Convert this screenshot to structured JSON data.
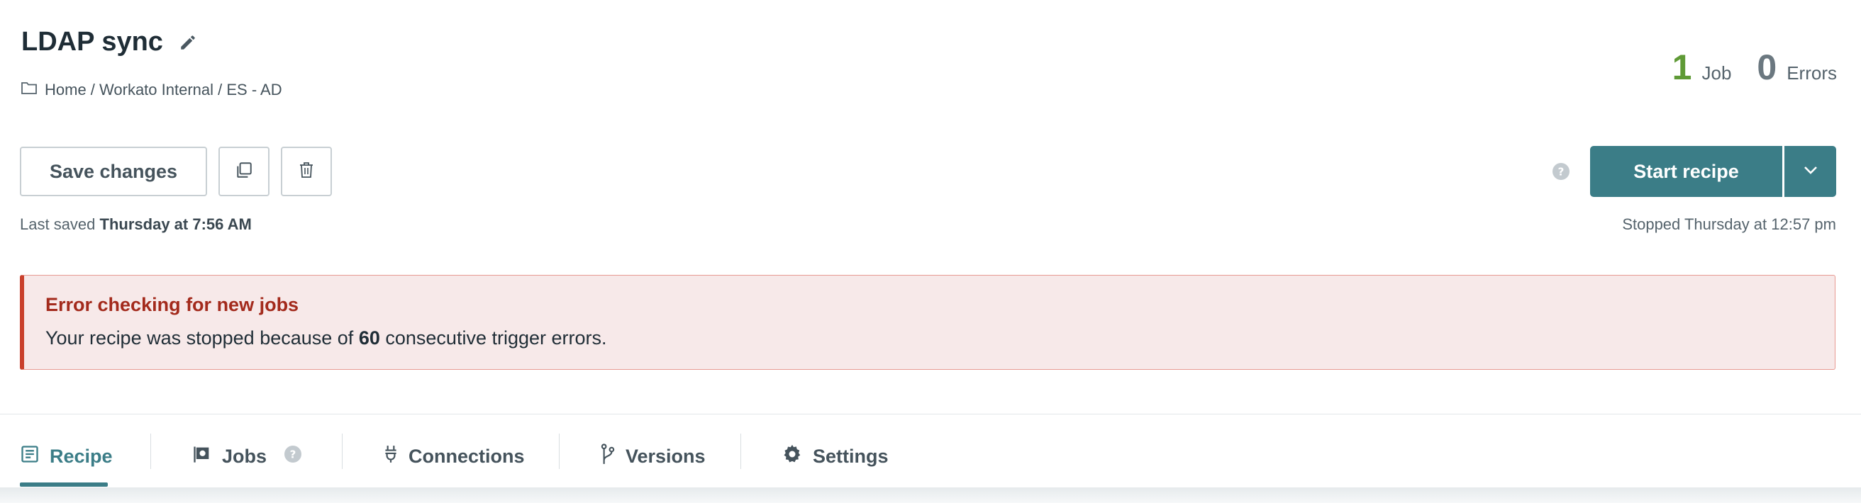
{
  "header": {
    "title": "LDAP sync",
    "breadcrumb": "Home / Workato Internal / ES - AD"
  },
  "stats": {
    "jobs_count": "1",
    "jobs_label": "Job",
    "errors_count": "0",
    "errors_label": "Errors"
  },
  "toolbar": {
    "save_label": "Save changes",
    "last_saved_prefix": "Last saved",
    "last_saved_time": "Thursday at 7:56 AM",
    "start_label": "Start recipe",
    "stopped_text": "Stopped Thursday at 12:57 pm"
  },
  "error": {
    "title": "Error checking for new jobs",
    "text_before": "Your recipe was stopped because of",
    "count": "60",
    "text_after": "consecutive trigger errors."
  },
  "tabs": [
    {
      "label": "Recipe",
      "icon": "document-icon",
      "active": true
    },
    {
      "label": "Jobs",
      "icon": "flag-icon",
      "active": false
    },
    {
      "label": "Connections",
      "icon": "plug-icon",
      "active": false
    },
    {
      "label": "Versions",
      "icon": "branch-icon",
      "active": false
    },
    {
      "label": "Settings",
      "icon": "gear-icon",
      "active": false
    }
  ],
  "colors": {
    "primary": "#3b7d87",
    "job_count": "#5f9a36",
    "error_border": "#c9402c",
    "error_bg": "#f7e9e9"
  }
}
